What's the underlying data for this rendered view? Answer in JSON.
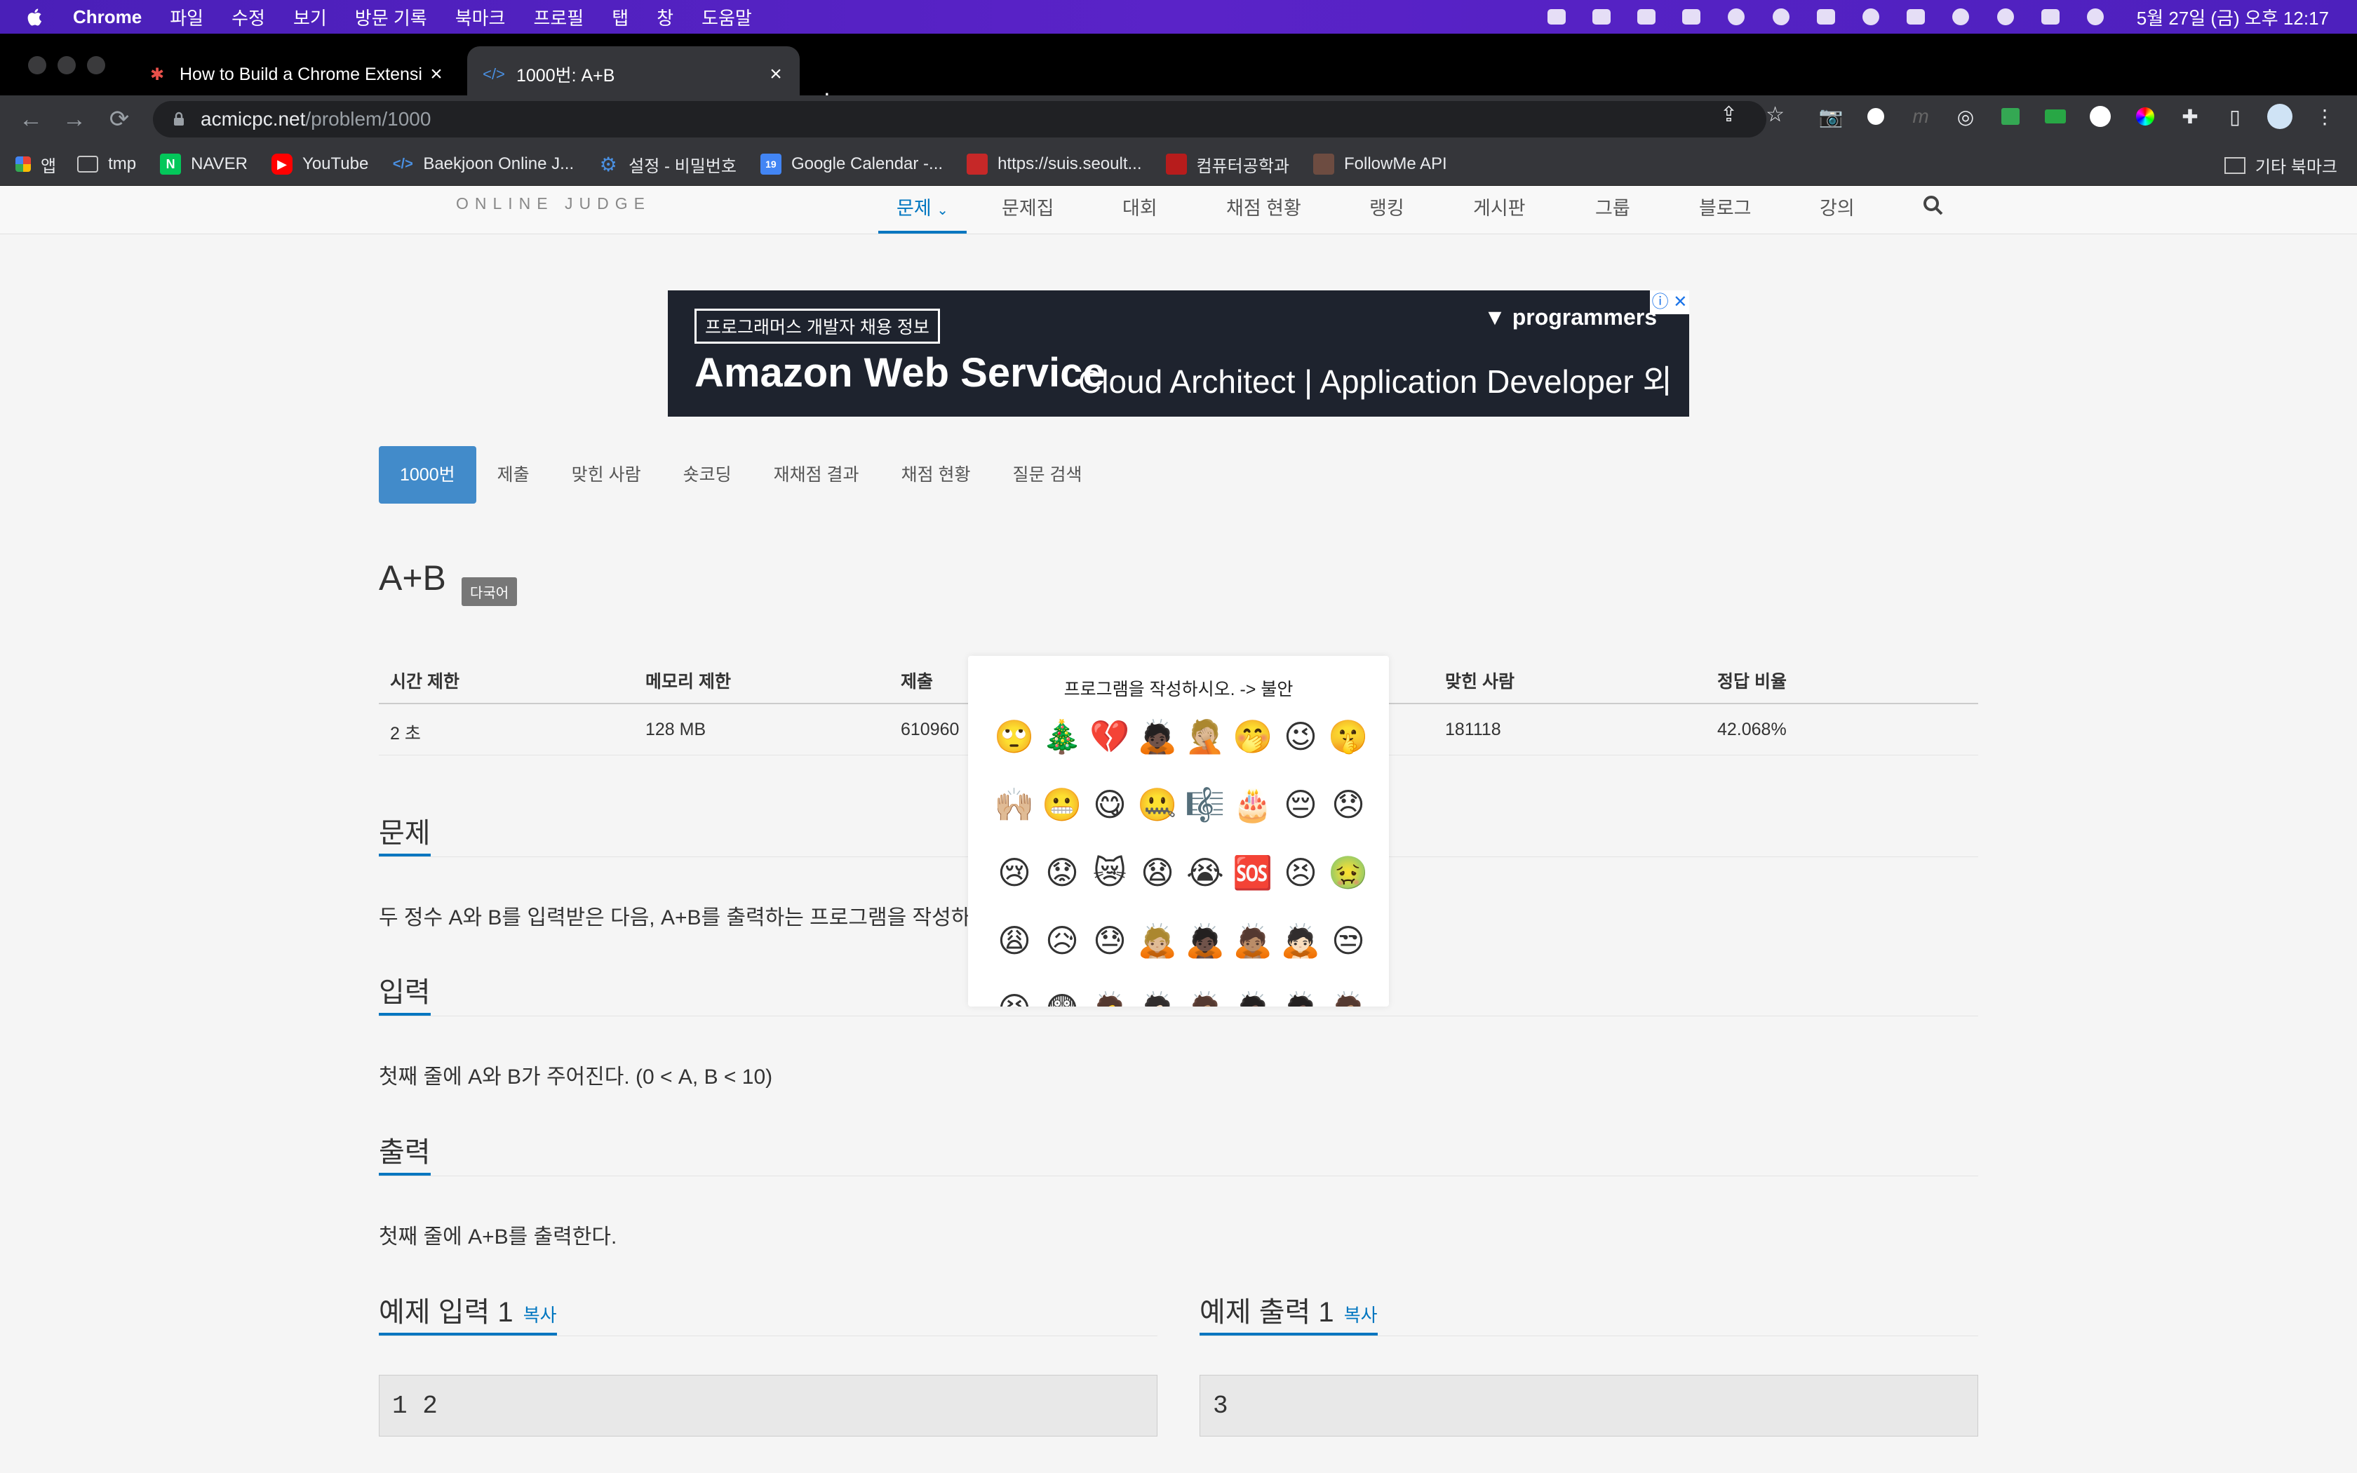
{
  "menubar": {
    "app_name": "Chrome",
    "items": [
      "파일",
      "수정",
      "보기",
      "방문 기록",
      "북마크",
      "프로필",
      "탭",
      "창",
      "도움말"
    ],
    "clock": "5월 27일 (금) 오후 12:17"
  },
  "tabs": [
    {
      "title": "How to Build a Chrome Extensi",
      "active": false
    },
    {
      "title": "1000번: A+B",
      "active": true
    }
  ],
  "omnibox": {
    "host": "acmicpc.net",
    "path": "/problem/1000"
  },
  "bookmarks": {
    "items": [
      "앱",
      "tmp",
      "NAVER",
      "YouTube",
      "Baekjoon Online J...",
      "설정 - 비밀번호",
      "Google Calendar -...",
      "https://suis.seoult...",
      "컴퓨터공학과",
      "FollowMe API"
    ],
    "other": "기타 북마크"
  },
  "site": {
    "logo": "ONLINE JUDGE",
    "nav": [
      "문제",
      "문제집",
      "대회",
      "채점 현황",
      "랭킹",
      "게시판",
      "그룹",
      "블로그",
      "강의"
    ]
  },
  "ad": {
    "badge": "프로그래머스 개발자 채용 정보",
    "brand": "programmers",
    "headline": "Amazon Web Service",
    "sub": "Cloud Architect | Application Developer 외"
  },
  "subtabs": [
    "1000번",
    "제출",
    "맞힌 사람",
    "숏코딩",
    "재채점 결과",
    "채점 현황",
    "질문 검색"
  ],
  "problem": {
    "title": "A+B",
    "lang_badge": "다국어",
    "table": {
      "headers": [
        "시간 제한",
        "메모리 제한",
        "제출",
        "",
        "맞힌 사람",
        "정답 비율"
      ],
      "values": [
        "2 초",
        "128 MB",
        "610960",
        "",
        "181118",
        "42.068%"
      ]
    },
    "sections": {
      "problem_h": "문제",
      "problem_p": "두 정수 A와 B를 입력받은 다음, A+B를 출력하는 프로그램을 작성하",
      "input_h": "입력",
      "input_p": "첫째 줄에 A와 B가 주어진다. (0 < A, B < 10)",
      "output_h": "출력",
      "output_p": "첫째 줄에 A+B를 출력한다."
    },
    "samples": {
      "input_title": "예제 입력 1",
      "output_title": "예제 출력 1",
      "copy": "복사",
      "input_value": "1  2",
      "output_value": "3"
    }
  },
  "emoji_popup": {
    "title": "프로그램을 작성하시오. -> 불안",
    "emojis": [
      "🙄",
      "🎄",
      "💔",
      "🙇🏿",
      "🤦🏼",
      "🤭",
      "😉",
      "🤫",
      "🙌🏼",
      "😬",
      "😋",
      "🤐",
      "🎼",
      "🎂",
      "😔",
      "😞",
      "😢",
      "😟",
      "😿",
      "😧",
      "😭",
      "🆘",
      "😣",
      "🤢",
      "😩",
      "😥",
      "😓",
      "🙇🏼",
      "🙇🏿",
      "🙇🏽",
      "🙇🏻",
      "😒",
      "😣",
      "😨",
      "🙇",
      "🙇🏻",
      "🙇🏽",
      "🙇🏿",
      "🙇🏿",
      "🙇🏽"
    ]
  }
}
